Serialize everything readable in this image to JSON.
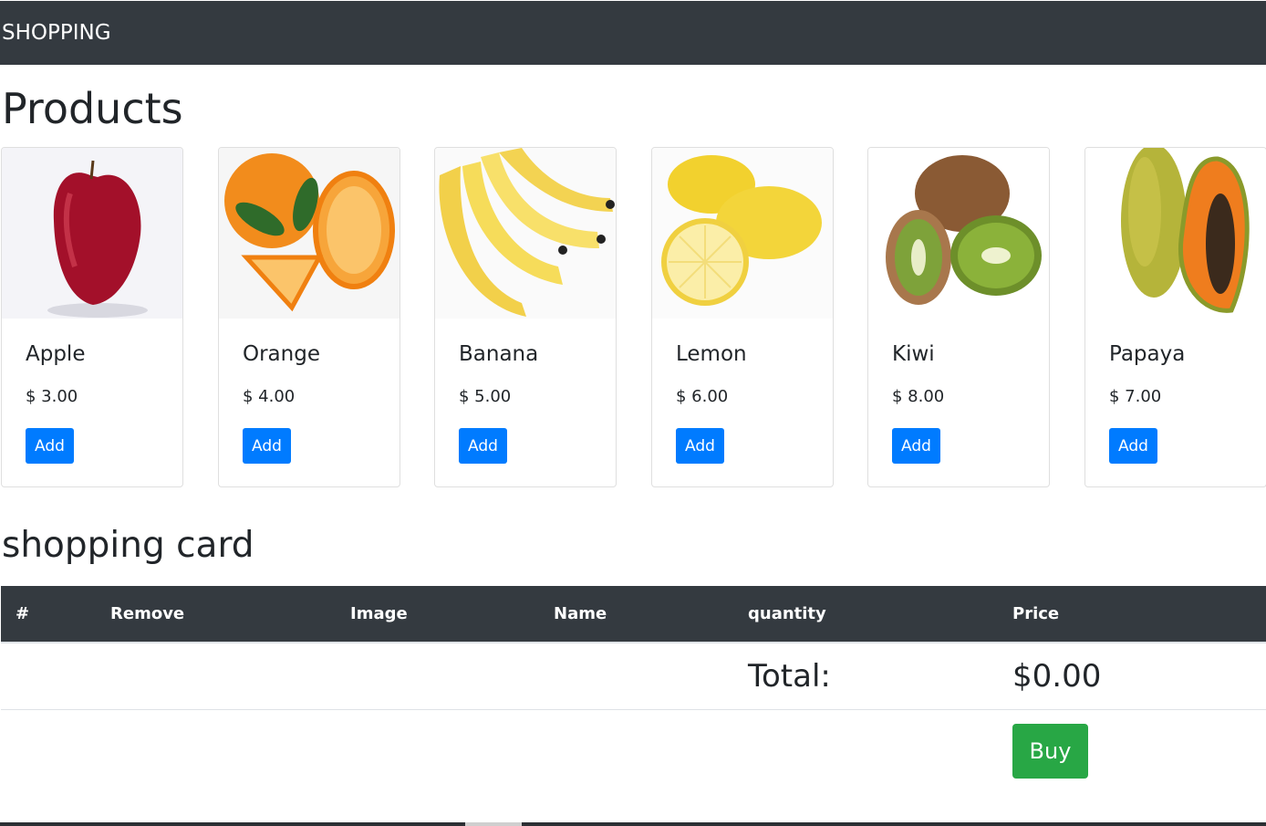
{
  "navbar": {
    "brand": "SHOPPING"
  },
  "products_title": "Products",
  "products": [
    {
      "name": "Apple",
      "price": "$ 3.00",
      "button": "Add",
      "image": "apple"
    },
    {
      "name": "Orange",
      "price": "$ 4.00",
      "button": "Add",
      "image": "orange"
    },
    {
      "name": "Banana",
      "price": "$ 5.00",
      "button": "Add",
      "image": "banana"
    },
    {
      "name": "Lemon",
      "price": "$ 6.00",
      "button": "Add",
      "image": "lemon"
    },
    {
      "name": "Kiwi",
      "price": "$ 8.00",
      "button": "Add",
      "image": "kiwi"
    },
    {
      "name": "Papaya",
      "price": "$ 7.00",
      "button": "Add",
      "image": "papaya"
    }
  ],
  "cart": {
    "title": "shopping card",
    "columns": [
      "#",
      "Remove",
      "Image",
      "Name",
      "quantity",
      "Price"
    ],
    "total_label": "Total:",
    "total_value": "$0.00",
    "buy_label": "Buy"
  },
  "colors": {
    "navbar": "#343a40",
    "primary": "#007bff",
    "success": "#28a745"
  }
}
